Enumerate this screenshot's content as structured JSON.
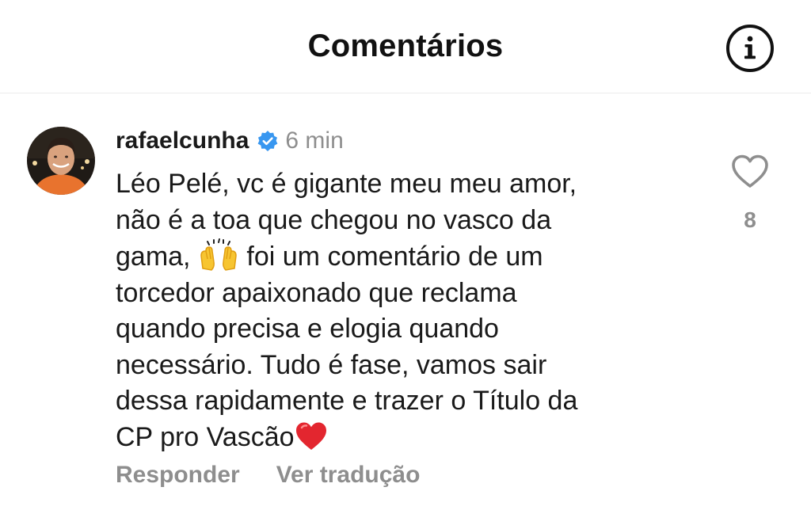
{
  "header": {
    "title": "Comentários",
    "info_icon": "info-circle-icon"
  },
  "comment": {
    "username": "rafaelcunha",
    "verified_icon": "verified-badge-icon",
    "verified_color": "#3897f0",
    "time": "6 min",
    "lines": [
      "Léo Pelé, vc é gigante meu meu amor,",
      "não é a toa que chegou no vasco da",
      "gama,",
      " foi um comentário de um",
      "torcedor apaixonado que reclama",
      "quando precisa e elogia quando",
      "necessário. Tudo é fase, vamos sair",
      "dessa rapidamente e trazer o Título da",
      "CP pro Vascão"
    ],
    "inline_emojis": [
      "raising-hands-emoji",
      "red-heart-emoji"
    ],
    "like_icon": "heart-outline-icon",
    "like_count": "8",
    "reply_label": "Responder",
    "translate_label": "Ver tradução"
  }
}
